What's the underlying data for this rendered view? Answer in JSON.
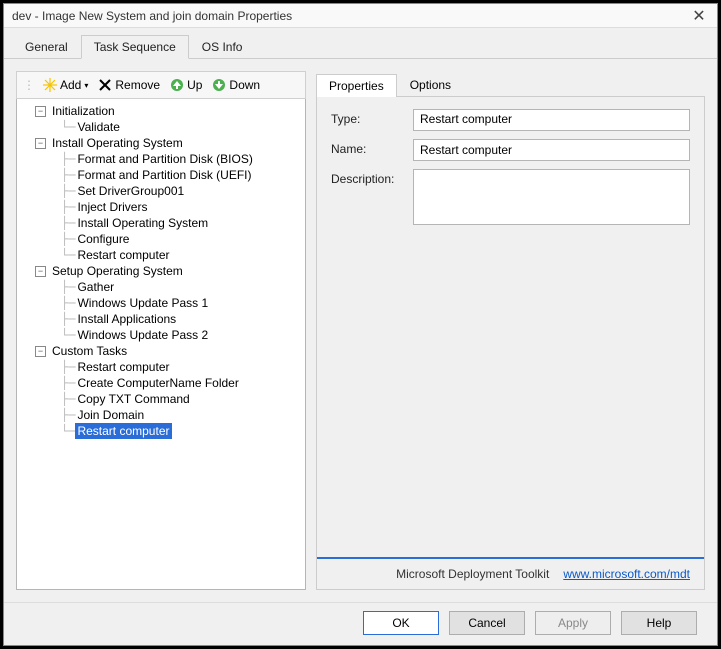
{
  "title": "dev - Image New System and join domain Properties",
  "top_tabs": [
    "General",
    "Task Sequence",
    "OS Info"
  ],
  "top_tab_active": "Task Sequence",
  "toolbar": {
    "add": "Add",
    "remove": "Remove",
    "up": "Up",
    "down": "Down"
  },
  "tree": {
    "groups": [
      {
        "label": "Initialization",
        "children": [
          "Validate"
        ]
      },
      {
        "label": "Install Operating System",
        "children": [
          "Format and Partition Disk (BIOS)",
          "Format and Partition Disk (UEFI)",
          "Set DriverGroup001",
          "Inject Drivers",
          "Install Operating System",
          "Configure",
          "Restart computer"
        ]
      },
      {
        "label": "Setup Operating System",
        "children": [
          "Gather",
          "Windows Update Pass 1",
          "Install Applications",
          "Windows Update Pass 2"
        ]
      },
      {
        "label": "Custom Tasks",
        "children": [
          "Restart computer",
          "Create ComputerName Folder",
          "Copy TXT Command",
          "Join Domain",
          "Restart computer"
        ]
      }
    ],
    "selected": {
      "group": 3,
      "child": 4
    }
  },
  "right": {
    "subtabs": [
      "Properties",
      "Options"
    ],
    "subtab_active": "Properties",
    "type_label": "Type:",
    "type_value": "Restart computer",
    "name_label": "Name:",
    "name_value": "Restart computer",
    "desc_label": "Description:",
    "desc_value": ""
  },
  "brand": {
    "text": "Microsoft Deployment Toolkit",
    "link_text": "www.microsoft.com/mdt"
  },
  "buttons": {
    "ok": "OK",
    "cancel": "Cancel",
    "apply": "Apply",
    "help": "Help"
  }
}
